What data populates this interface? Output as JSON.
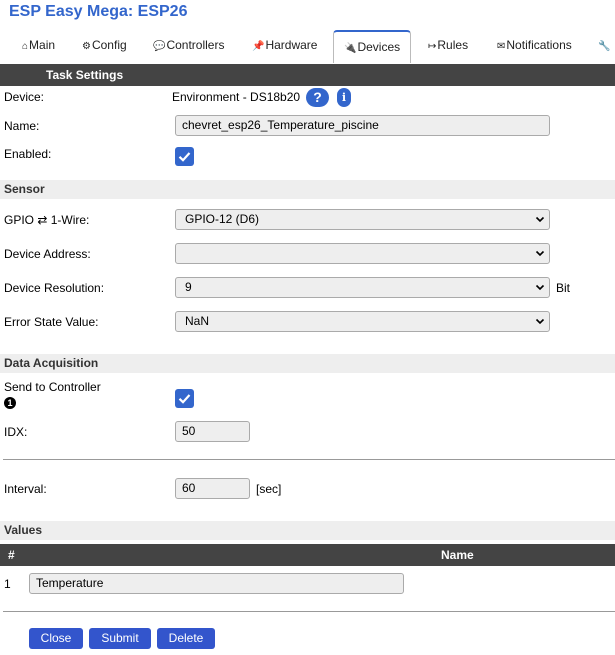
{
  "app": {
    "title": "ESP Easy Mega: ESP26"
  },
  "tabs": [
    {
      "icon": "⌂",
      "label": "Main"
    },
    {
      "icon": "⚙",
      "label": "Config"
    },
    {
      "icon": "💬",
      "label": "Controllers"
    },
    {
      "icon": "📌",
      "label": "Hardware"
    },
    {
      "icon": "🔌",
      "label": "Devices"
    },
    {
      "icon": "↦",
      "label": "Rules"
    },
    {
      "icon": "✉",
      "label": "Notifications"
    },
    {
      "icon": "🔧",
      "label": ""
    }
  ],
  "task_settings": {
    "header": "Task Settings",
    "device_label": "Device:",
    "device_value": "Environment - DS18b20",
    "help_glyph": "?",
    "info_glyph": "i",
    "name_label": "Name:",
    "name_value": "chevret_esp26_Temperature_piscine",
    "enabled_label": "Enabled:"
  },
  "sensor": {
    "header": "Sensor",
    "gpio_label": "GPIO ⇄ 1-Wire:",
    "gpio_value": "GPIO-12 (D6)",
    "address_label": "Device Address:",
    "address_value": "",
    "resolution_label": "Device Resolution:",
    "resolution_value": "9",
    "resolution_unit": "Bit",
    "error_label": "Error State Value:",
    "error_value": "NaN"
  },
  "acquisition": {
    "header": "Data Acquisition",
    "send_label": "Send to Controller",
    "send_note_glyph": "1",
    "idx_label": "IDX:",
    "idx_value": "50",
    "interval_label": "Interval:",
    "interval_value": "60",
    "interval_unit": "[sec]"
  },
  "values": {
    "header": "Values",
    "col_num": "#",
    "col_name": "Name",
    "rows": [
      {
        "num": "1",
        "name": "Temperature"
      }
    ]
  },
  "buttons": {
    "close": "Close",
    "submit": "Submit",
    "delete": "Delete"
  },
  "colors": {
    "accent": "#3366cc",
    "bar": "#444444",
    "section": "#eeeeee"
  }
}
